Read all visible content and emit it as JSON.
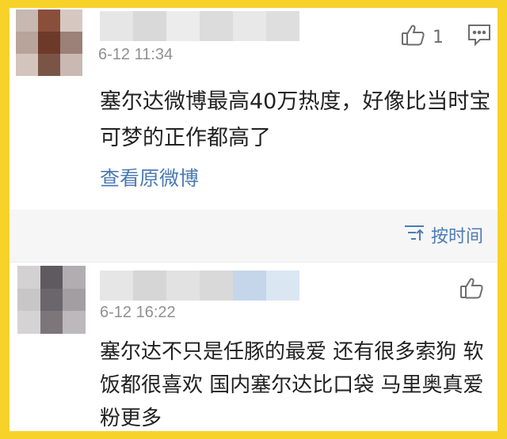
{
  "comments": [
    {
      "timestamp": "6-12 11:34",
      "text": "塞尔达微博最高40万热度，好像比当时宝可梦的正作都高了",
      "view_link": "查看原微博",
      "like_count": "1",
      "avatar_colors": [
        "#c7b8b1",
        "#8a4f3a",
        "#d6c8c1",
        "#b8a49b",
        "#6d3a2a",
        "#9b8177",
        "#d3c4bd",
        "#7a5546",
        "#c9b9b2"
      ],
      "name_blur_colors": [
        "#e6e6e6",
        "#d9d9d9",
        "#ececec",
        "#dcdcdc",
        "#e8e8e8",
        "#dedede"
      ]
    },
    {
      "timestamp": "6-12 16:22",
      "text": "塞尔达不只是任豚的最爱 还有很多索狗 软饭都很喜欢 国内塞尔达比口袋 马里奥真爱粉更多",
      "avatar_colors": [
        "#d4d1d3",
        "#5f5a5f",
        "#b1adb0",
        "#c9c6c8",
        "#6b666b",
        "#a29ea1",
        "#d6d3d5",
        "#7c767b",
        "#bcb8bb"
      ],
      "name_blur_colors": [
        "#e6e6e6",
        "#d6d6d6",
        "#e2e2e2",
        "#d9d9d9",
        "#c6d6ea",
        "#dbe6f3"
      ]
    }
  ],
  "sort_label": "按时间",
  "icons": [
    "thumbs-up-icon",
    "comment-icon",
    "sort-icon"
  ],
  "colors": {
    "frame": "#f7d229",
    "link": "#4c7bb4",
    "meta": "#909090"
  }
}
